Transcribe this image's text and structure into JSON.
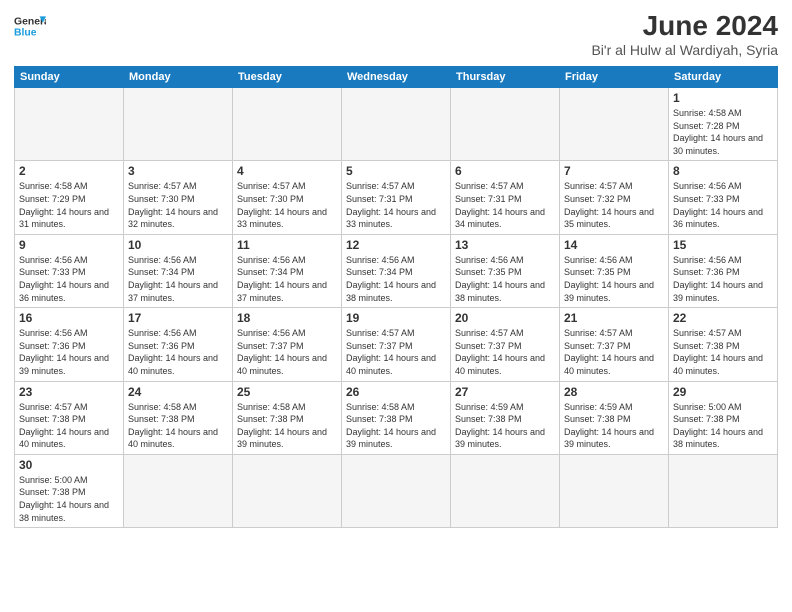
{
  "header": {
    "logo_general": "General",
    "logo_blue": "Blue",
    "month_title": "June 2024",
    "location": "Bi'r al Hulw al Wardiyah, Syria"
  },
  "weekdays": [
    "Sunday",
    "Monday",
    "Tuesday",
    "Wednesday",
    "Thursday",
    "Friday",
    "Saturday"
  ],
  "weeks": [
    [
      {
        "day": "",
        "info": ""
      },
      {
        "day": "",
        "info": ""
      },
      {
        "day": "",
        "info": ""
      },
      {
        "day": "",
        "info": ""
      },
      {
        "day": "",
        "info": ""
      },
      {
        "day": "",
        "info": ""
      },
      {
        "day": "1",
        "info": "Sunrise: 4:58 AM\nSunset: 7:28 PM\nDaylight: 14 hours and 30 minutes."
      }
    ],
    [
      {
        "day": "2",
        "info": "Sunrise: 4:58 AM\nSunset: 7:29 PM\nDaylight: 14 hours and 31 minutes."
      },
      {
        "day": "3",
        "info": "Sunrise: 4:57 AM\nSunset: 7:30 PM\nDaylight: 14 hours and 32 minutes."
      },
      {
        "day": "4",
        "info": "Sunrise: 4:57 AM\nSunset: 7:30 PM\nDaylight: 14 hours and 33 minutes."
      },
      {
        "day": "5",
        "info": "Sunrise: 4:57 AM\nSunset: 7:31 PM\nDaylight: 14 hours and 33 minutes."
      },
      {
        "day": "6",
        "info": "Sunrise: 4:57 AM\nSunset: 7:31 PM\nDaylight: 14 hours and 34 minutes."
      },
      {
        "day": "7",
        "info": "Sunrise: 4:57 AM\nSunset: 7:32 PM\nDaylight: 14 hours and 35 minutes."
      },
      {
        "day": "8",
        "info": "Sunrise: 4:56 AM\nSunset: 7:33 PM\nDaylight: 14 hours and 36 minutes."
      }
    ],
    [
      {
        "day": "9",
        "info": "Sunrise: 4:56 AM\nSunset: 7:33 PM\nDaylight: 14 hours and 36 minutes."
      },
      {
        "day": "10",
        "info": "Sunrise: 4:56 AM\nSunset: 7:34 PM\nDaylight: 14 hours and 37 minutes."
      },
      {
        "day": "11",
        "info": "Sunrise: 4:56 AM\nSunset: 7:34 PM\nDaylight: 14 hours and 37 minutes."
      },
      {
        "day": "12",
        "info": "Sunrise: 4:56 AM\nSunset: 7:34 PM\nDaylight: 14 hours and 38 minutes."
      },
      {
        "day": "13",
        "info": "Sunrise: 4:56 AM\nSunset: 7:35 PM\nDaylight: 14 hours and 38 minutes."
      },
      {
        "day": "14",
        "info": "Sunrise: 4:56 AM\nSunset: 7:35 PM\nDaylight: 14 hours and 39 minutes."
      },
      {
        "day": "15",
        "info": "Sunrise: 4:56 AM\nSunset: 7:36 PM\nDaylight: 14 hours and 39 minutes."
      }
    ],
    [
      {
        "day": "16",
        "info": "Sunrise: 4:56 AM\nSunset: 7:36 PM\nDaylight: 14 hours and 39 minutes."
      },
      {
        "day": "17",
        "info": "Sunrise: 4:56 AM\nSunset: 7:36 PM\nDaylight: 14 hours and 40 minutes."
      },
      {
        "day": "18",
        "info": "Sunrise: 4:56 AM\nSunset: 7:37 PM\nDaylight: 14 hours and 40 minutes."
      },
      {
        "day": "19",
        "info": "Sunrise: 4:57 AM\nSunset: 7:37 PM\nDaylight: 14 hours and 40 minutes."
      },
      {
        "day": "20",
        "info": "Sunrise: 4:57 AM\nSunset: 7:37 PM\nDaylight: 14 hours and 40 minutes."
      },
      {
        "day": "21",
        "info": "Sunrise: 4:57 AM\nSunset: 7:37 PM\nDaylight: 14 hours and 40 minutes."
      },
      {
        "day": "22",
        "info": "Sunrise: 4:57 AM\nSunset: 7:38 PM\nDaylight: 14 hours and 40 minutes."
      }
    ],
    [
      {
        "day": "23",
        "info": "Sunrise: 4:57 AM\nSunset: 7:38 PM\nDaylight: 14 hours and 40 minutes."
      },
      {
        "day": "24",
        "info": "Sunrise: 4:58 AM\nSunset: 7:38 PM\nDaylight: 14 hours and 40 minutes."
      },
      {
        "day": "25",
        "info": "Sunrise: 4:58 AM\nSunset: 7:38 PM\nDaylight: 14 hours and 39 minutes."
      },
      {
        "day": "26",
        "info": "Sunrise: 4:58 AM\nSunset: 7:38 PM\nDaylight: 14 hours and 39 minutes."
      },
      {
        "day": "27",
        "info": "Sunrise: 4:59 AM\nSunset: 7:38 PM\nDaylight: 14 hours and 39 minutes."
      },
      {
        "day": "28",
        "info": "Sunrise: 4:59 AM\nSunset: 7:38 PM\nDaylight: 14 hours and 39 minutes."
      },
      {
        "day": "29",
        "info": "Sunrise: 5:00 AM\nSunset: 7:38 PM\nDaylight: 14 hours and 38 minutes."
      }
    ],
    [
      {
        "day": "30",
        "info": "Sunrise: 5:00 AM\nSunset: 7:38 PM\nDaylight: 14 hours and 38 minutes."
      },
      {
        "day": "",
        "info": ""
      },
      {
        "day": "",
        "info": ""
      },
      {
        "day": "",
        "info": ""
      },
      {
        "day": "",
        "info": ""
      },
      {
        "day": "",
        "info": ""
      },
      {
        "day": "",
        "info": ""
      }
    ]
  ]
}
